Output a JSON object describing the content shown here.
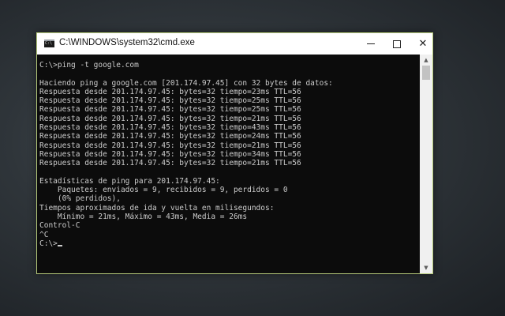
{
  "window": {
    "title": "C:\\WINDOWS\\system32\\cmd.exe",
    "icon": "cmd-icon",
    "accent_border": "#b5c97a",
    "controls": {
      "minimize_icon": "minimize-icon",
      "maximize_icon": "maximize-icon",
      "close_icon": "close-icon",
      "close_glyph": "✕"
    }
  },
  "console": {
    "background": "#0c0c0c",
    "foreground": "#cccccc",
    "lines": [
      "C:\\>ping -t google.com",
      "",
      "Haciendo ping a google.com [201.174.97.45] con 32 bytes de datos:",
      "Respuesta desde 201.174.97.45: bytes=32 tiempo=23ms TTL=56",
      "Respuesta desde 201.174.97.45: bytes=32 tiempo=25ms TTL=56",
      "Respuesta desde 201.174.97.45: bytes=32 tiempo=25ms TTL=56",
      "Respuesta desde 201.174.97.45: bytes=32 tiempo=21ms TTL=56",
      "Respuesta desde 201.174.97.45: bytes=32 tiempo=43ms TTL=56",
      "Respuesta desde 201.174.97.45: bytes=32 tiempo=24ms TTL=56",
      "Respuesta desde 201.174.97.45: bytes=32 tiempo=21ms TTL=56",
      "Respuesta desde 201.174.97.45: bytes=32 tiempo=34ms TTL=56",
      "Respuesta desde 201.174.97.45: bytes=32 tiempo=21ms TTL=56",
      "",
      "Estadísticas de ping para 201.174.97.45:",
      "    Paquetes: enviados = 9, recibidos = 9, perdidos = 0",
      "    (0% perdidos),",
      "Tiempos aproximados de ida y vuelta en milisegundos:",
      "    Mínimo = 21ms, Máximo = 43ms, Media = 26ms",
      "Control-C",
      "^C"
    ],
    "prompt": "C:\\>"
  },
  "scrollbar": {
    "up_icon": "scroll-up-arrow-icon",
    "down_icon": "scroll-down-arrow-icon"
  }
}
